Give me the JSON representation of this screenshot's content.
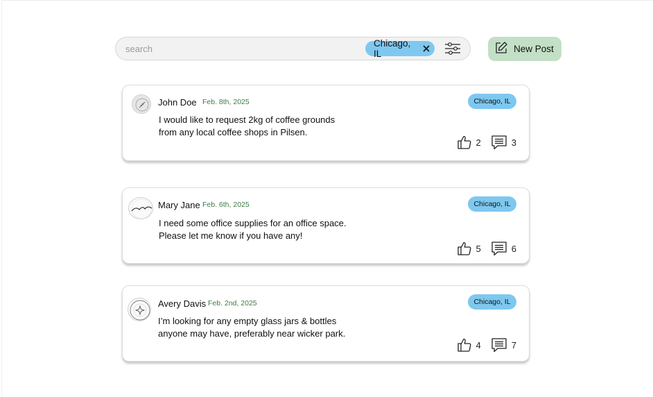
{
  "search": {
    "placeholder": "search",
    "location_chip": "Chicago, IL"
  },
  "toolbar": {
    "new_post_label": "New Post"
  },
  "colors": {
    "chip_blue": "#7ec8f0",
    "new_post_green": "#c3e0c6",
    "date_green": "#3e7a45"
  },
  "posts": [
    {
      "author": "John Doe",
      "date": "Feb. 8th, 2025",
      "location": "Chicago, IL",
      "text": "I would like to request 2kg of coffee grounds from any local coffee shops in Pilsen.",
      "likes": "2",
      "comments": "3"
    },
    {
      "author": "Mary Jane",
      "date": "Feb. 6th, 2025",
      "location": "Chicago, IL",
      "text": "I need some office supplies for an office space. Please let me know if you have any!",
      "likes": "5",
      "comments": "6"
    },
    {
      "author": "Avery Davis",
      "date": "Feb. 2nd, 2025",
      "location": "Chicago, IL",
      "text": "I’m looking for any empty glass jars & bottles anyone may have, preferably near wicker park.",
      "likes": "4",
      "comments": "7"
    }
  ],
  "icons": {
    "clear": "close-icon",
    "filter": "filter-sliders-icon",
    "new_post": "edit-icon",
    "like": "thumbs-up-icon",
    "comment": "comment-icon"
  }
}
